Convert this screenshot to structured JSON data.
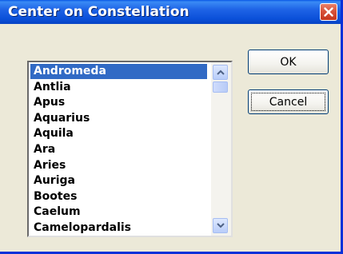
{
  "window": {
    "title": "Center on Constellation"
  },
  "list": {
    "items": [
      {
        "label": "Andromeda",
        "selected": true
      },
      {
        "label": "Antlia"
      },
      {
        "label": "Apus"
      },
      {
        "label": "Aquarius"
      },
      {
        "label": "Aquila"
      },
      {
        "label": "Ara"
      },
      {
        "label": "Aries"
      },
      {
        "label": "Auriga"
      },
      {
        "label": "Bootes"
      },
      {
        "label": "Caelum"
      },
      {
        "label": "Camelopardalis"
      }
    ]
  },
  "buttons": {
    "ok_label": "OK",
    "cancel_label": "Cancel"
  },
  "icons": {
    "close": "close-icon",
    "scroll_up": "scroll-up-arrow-icon",
    "scroll_down": "scroll-down-arrow-icon"
  },
  "colors": {
    "title_bar": "#0a4fd8",
    "selection": "#316ac5",
    "close_button": "#d9533a",
    "dialog_background": "#ece9d8"
  }
}
